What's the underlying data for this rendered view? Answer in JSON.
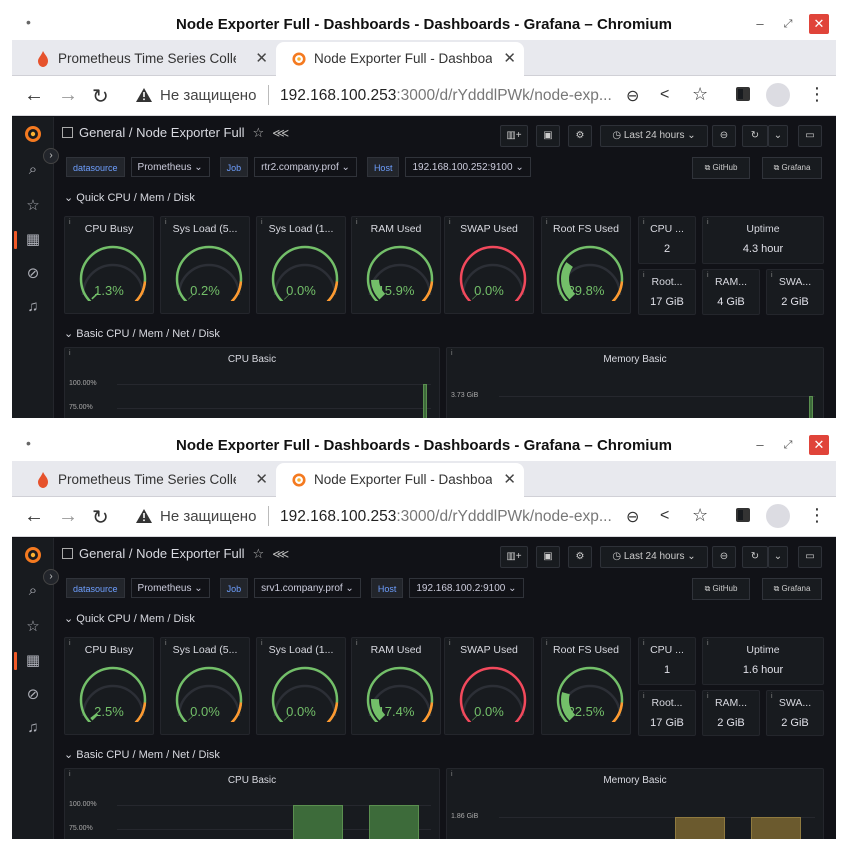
{
  "screenshots": [
    {
      "window_title": "Node Exporter Full - Dashboards - Dashboards - Grafana – Chromium",
      "tabs": [
        {
          "label": "Prometheus Time Series Colle"
        },
        {
          "label": "Node Exporter Full - Dashboa"
        }
      ],
      "address": {
        "insecure_label": "Не защищено",
        "url_host": "192.168.100.253",
        "url_rest": ":3000/d/rYdddlPWk/node-exp..."
      },
      "breadcrumb": "General / Node Exporter Full",
      "time_range": "Last 24 hours",
      "variables": {
        "datasource_label": "datasource",
        "datasource": "Prometheus",
        "job_label": "Job",
        "job": "rtr2.company.prof",
        "host_label": "Host",
        "host": "192.168.100.252:9100"
      },
      "links": {
        "github": "GitHub",
        "grafana": "Grafana"
      },
      "rows": {
        "quick": "Quick CPU / Mem / Disk",
        "basic": "Basic CPU / Mem / Net / Disk"
      },
      "gauges": [
        {
          "title": "CPU Busy",
          "value": "1.3%",
          "level": 0.013
        },
        {
          "title": "Sys Load (5...",
          "value": "0.2%",
          "level": 0.002
        },
        {
          "title": "Sys Load (1...",
          "value": "0.0%",
          "level": 0.0
        },
        {
          "title": "RAM Used",
          "value": "15.9%",
          "level": 0.159
        },
        {
          "title": "SWAP Used",
          "value": "0.0%",
          "level": 0.0
        },
        {
          "title": "Root FS Used",
          "value": "29.8%",
          "level": 0.298
        }
      ],
      "stats": [
        {
          "title": "CPU ...",
          "value": "2"
        },
        {
          "title": "Uptime",
          "value": "4.3 hour"
        },
        {
          "title": "Root...",
          "value": "17 GiB"
        },
        {
          "title": "RAM...",
          "value": "4 GiB"
        },
        {
          "title": "SWA...",
          "value": "2 GiB"
        }
      ],
      "cpu_basic": {
        "title": "CPU Basic",
        "ticks": [
          "100.00%",
          "75.00%"
        ]
      },
      "memory_basic": {
        "title": "Memory Basic",
        "ticks": [
          "3.73 GiB"
        ]
      }
    },
    {
      "window_title": "Node Exporter Full - Dashboards - Dashboards - Grafana – Chromium",
      "tabs": [
        {
          "label": "Prometheus Time Series Colle"
        },
        {
          "label": "Node Exporter Full - Dashboa"
        }
      ],
      "address": {
        "insecure_label": "Не защищено",
        "url_host": "192.168.100.253",
        "url_rest": ":3000/d/rYdddlPWk/node-exp..."
      },
      "breadcrumb": "General / Node Exporter Full",
      "time_range": "Last 24 hours",
      "variables": {
        "datasource_label": "datasource",
        "datasource": "Prometheus",
        "job_label": "Job",
        "job": "srv1.company.prof",
        "host_label": "Host",
        "host": "192.168.100.2:9100"
      },
      "links": {
        "github": "GitHub",
        "grafana": "Grafana"
      },
      "rows": {
        "quick": "Quick CPU / Mem / Disk",
        "basic": "Basic CPU / Mem / Net / Disk"
      },
      "gauges": [
        {
          "title": "CPU Busy",
          "value": "2.5%",
          "level": 0.025
        },
        {
          "title": "Sys Load (5...",
          "value": "0.0%",
          "level": 0.0
        },
        {
          "title": "Sys Load (1...",
          "value": "0.0%",
          "level": 0.0
        },
        {
          "title": "RAM Used",
          "value": "17.4%",
          "level": 0.174
        },
        {
          "title": "SWAP Used",
          "value": "0.0%",
          "level": 0.0
        },
        {
          "title": "Root FS Used",
          "value": "22.5%",
          "level": 0.225
        }
      ],
      "stats": [
        {
          "title": "CPU ...",
          "value": "1"
        },
        {
          "title": "Uptime",
          "value": "1.6 hour"
        },
        {
          "title": "Root...",
          "value": "17 GiB"
        },
        {
          "title": "RAM...",
          "value": "2 GiB"
        },
        {
          "title": "SWA...",
          "value": "2 GiB"
        }
      ],
      "cpu_basic": {
        "title": "CPU Basic",
        "ticks": [
          "100.00%",
          "75.00%"
        ]
      },
      "memory_basic": {
        "title": "Memory Basic",
        "ticks": [
          "1.86 GiB"
        ]
      }
    }
  ],
  "colors": {
    "grafana_bg": "#111217",
    "panel_bg": "#181b1f",
    "gauge_green": "#73bf69",
    "gauge_red": "#f2495c",
    "gauge_orange": "#ff9830",
    "accent": "#f05a28"
  }
}
